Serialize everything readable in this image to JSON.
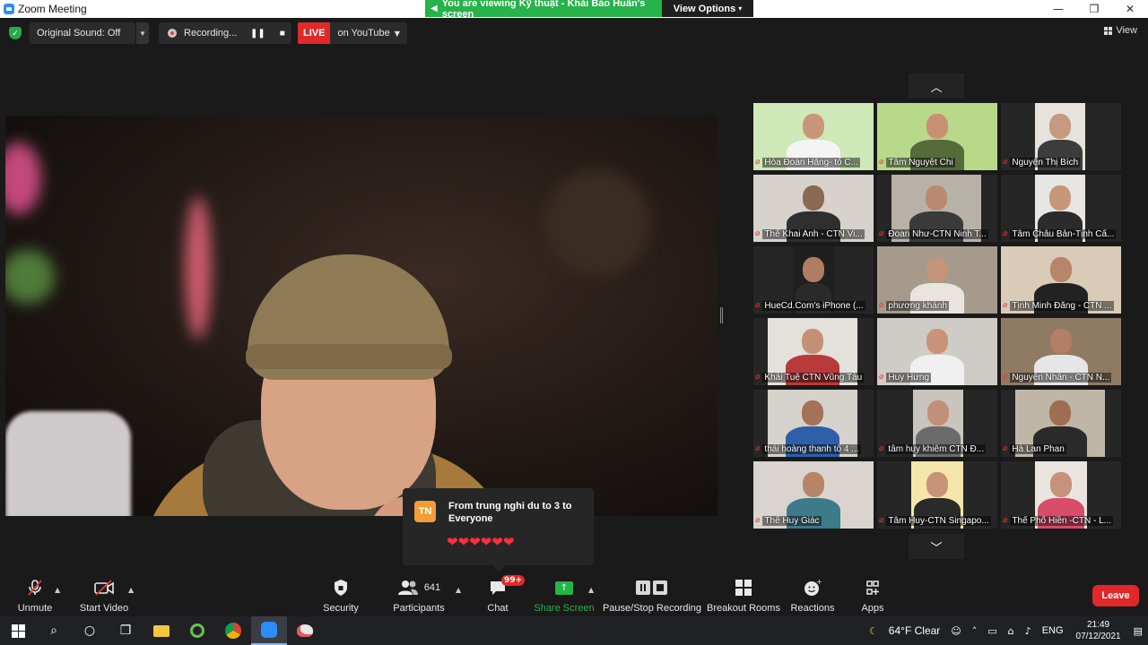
{
  "window": {
    "title": "Zoom Meeting",
    "controls": [
      "—",
      "❐",
      "✕"
    ]
  },
  "share_banner": {
    "message": "You are viewing Kỹ thuật - Khải Báo Huấn's screen",
    "view_options": "View Options"
  },
  "topbar": {
    "original_sound": "Original Sound: Off",
    "recording": "Recording...",
    "live_badge": "LIVE",
    "live_target": "on YouTube",
    "view": "View"
  },
  "gallery": {
    "tiles": [
      {
        "name": "Hòa Đoàn Hằng- tổ C..."
      },
      {
        "name": "Tâm Nguyệt Chi"
      },
      {
        "name": "Nguyễn Thị Bích"
      },
      {
        "name": "Thể Khai Anh - CTN Vi..."
      },
      {
        "name": "Đoan Như-CTN Ninh T..."
      },
      {
        "name": "Tâm Châu Bản-Tịnh Cẩ..."
      },
      {
        "name": "HueCd.Com's iPhone (..."
      },
      {
        "name": "phương khánh"
      },
      {
        "name": "Tịnh Minh Đăng - CTN ..."
      },
      {
        "name": "Khải Tuệ CTN Vũng Tàu"
      },
      {
        "name": "Huy Hưng"
      },
      {
        "name": "Nguyễn Nhẫn - CTN N..."
      },
      {
        "name": "thái hoàng thanh tổ 4 ..."
      },
      {
        "name": "tâm huy khiêm CTN Đ..."
      },
      {
        "name": "Hà Lan Phan"
      },
      {
        "name": "Thể Huy Giác"
      },
      {
        "name": "Tâm Huy-CTN Singapo..."
      },
      {
        "name": "Thể Phổ Hiền -CTN - L..."
      }
    ]
  },
  "chat_toast": {
    "avatar": "TN",
    "title": "From trung nghi du to 3 to Everyone",
    "message": "❤❤❤❤❤❤"
  },
  "controls": {
    "unmute": "Unmute",
    "start_video": "Start Video",
    "security": "Security",
    "participants": "Participants",
    "participants_count": "641",
    "chat": "Chat",
    "chat_badge": "99+",
    "share_screen": "Share Screen",
    "pause_stop_recording": "Pause/Stop Recording",
    "breakout_rooms": "Breakout Rooms",
    "reactions": "Reactions",
    "apps": "Apps",
    "leave": "Leave"
  },
  "taskbar": {
    "weather": "64°F  Clear",
    "language": "ENG",
    "time": "21:49",
    "date": "07/12/2021"
  },
  "colors": {
    "accent_green": "#25b34a",
    "live_red": "#e02a2a",
    "leave_red": "#e02828",
    "zoom_blue": "#2d8cff"
  }
}
